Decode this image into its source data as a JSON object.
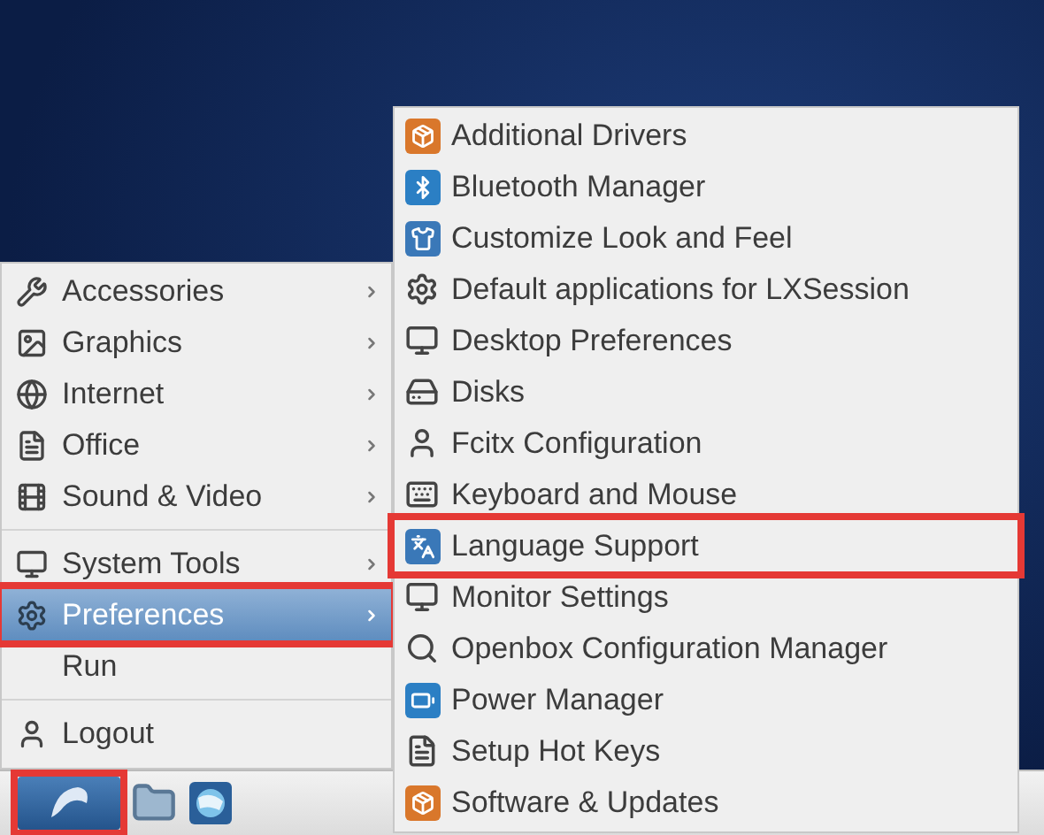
{
  "main_menu": {
    "groups": [
      [
        {
          "label": "Accessories",
          "kind": "submenu",
          "selected": false,
          "outlined": false
        },
        {
          "label": "Graphics",
          "kind": "submenu",
          "selected": false,
          "outlined": false
        },
        {
          "label": "Internet",
          "kind": "submenu",
          "selected": false,
          "outlined": false
        },
        {
          "label": "Office",
          "kind": "submenu",
          "selected": false,
          "outlined": false
        },
        {
          "label": "Sound & Video",
          "kind": "submenu",
          "selected": false,
          "outlined": false
        }
      ],
      [
        {
          "label": "System Tools",
          "kind": "submenu",
          "selected": false,
          "outlined": false
        },
        {
          "label": "Preferences",
          "kind": "submenu",
          "selected": true,
          "outlined": true
        },
        {
          "label": "Run",
          "kind": "action",
          "selected": false,
          "outlined": false
        }
      ],
      [
        {
          "label": "Logout",
          "kind": "action",
          "selected": false,
          "outlined": false
        }
      ]
    ]
  },
  "submenu": {
    "items": [
      {
        "label": "Additional Drivers",
        "selected": false,
        "outlined": false
      },
      {
        "label": "Bluetooth Manager",
        "selected": false,
        "outlined": false
      },
      {
        "label": "Customize Look and Feel",
        "selected": false,
        "outlined": false
      },
      {
        "label": "Default applications for LXSession",
        "selected": false,
        "outlined": false
      },
      {
        "label": "Desktop Preferences",
        "selected": false,
        "outlined": false
      },
      {
        "label": "Disks",
        "selected": false,
        "outlined": false
      },
      {
        "label": "Fcitx Configuration",
        "selected": false,
        "outlined": false
      },
      {
        "label": "Keyboard and Mouse",
        "selected": false,
        "outlined": false
      },
      {
        "label": "Language Support",
        "selected": false,
        "outlined": true
      },
      {
        "label": "Monitor Settings",
        "selected": false,
        "outlined": false
      },
      {
        "label": "Openbox Configuration Manager",
        "selected": false,
        "outlined": false
      },
      {
        "label": "Power Manager",
        "selected": false,
        "outlined": false
      },
      {
        "label": "Setup Hot Keys",
        "selected": false,
        "outlined": false
      },
      {
        "label": "Software & Updates",
        "selected": false,
        "outlined": false
      }
    ]
  },
  "panel": {
    "start_button": {
      "outlined": true
    }
  }
}
